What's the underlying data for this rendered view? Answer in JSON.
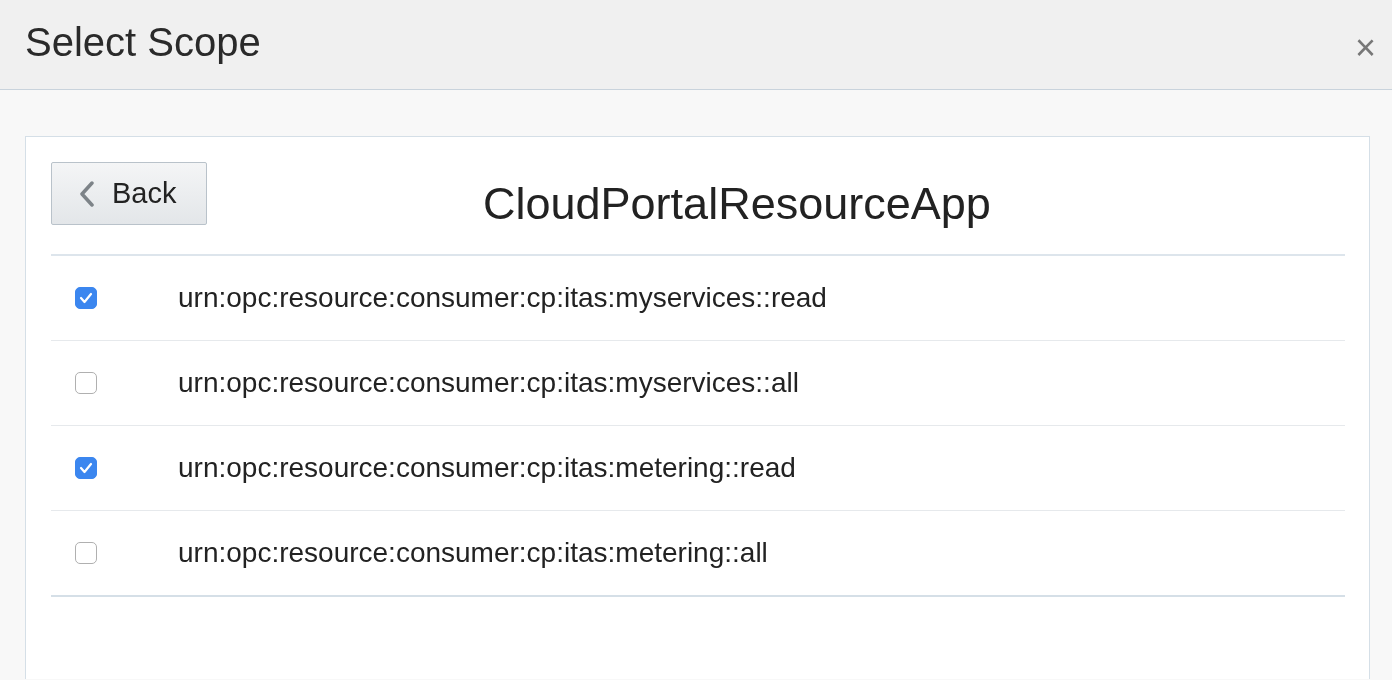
{
  "dialog": {
    "title": "Select Scope",
    "close": "×"
  },
  "back_button": {
    "label": "Back"
  },
  "app_name": "CloudPortalResourceApp",
  "scopes": [
    {
      "label": "urn:opc:resource:consumer:cp:itas:myservices::read",
      "checked": true
    },
    {
      "label": "urn:opc:resource:consumer:cp:itas:myservices::all",
      "checked": false
    },
    {
      "label": "urn:opc:resource:consumer:cp:itas:metering::read",
      "checked": true
    },
    {
      "label": "urn:opc:resource:consumer:cp:itas:metering::all",
      "checked": false
    }
  ]
}
